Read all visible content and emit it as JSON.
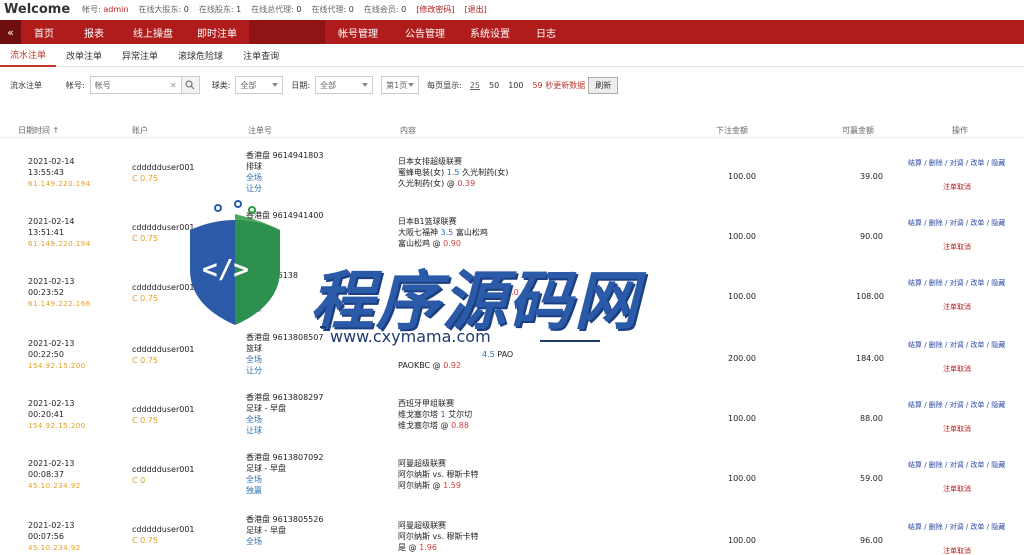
{
  "top": {
    "welcome": "Welcome",
    "account_label": "帐号:",
    "account": "admin",
    "stats": [
      {
        "label": "在线大股东:",
        "value": "0",
        "red": false
      },
      {
        "label": "在线股东:",
        "value": "1",
        "red": false
      },
      {
        "label": "在线总代理:",
        "value": "0",
        "red": false
      },
      {
        "label": "在线代理:",
        "value": "0",
        "red": false
      },
      {
        "label": "在线会员:",
        "value": "0",
        "red": false
      }
    ],
    "change_password": "[修改密码]",
    "logout": "[退出]"
  },
  "nav": {
    "collapse_icon": "«",
    "items": [
      "首页",
      "报表",
      "线上操盘",
      "即时注单",
      "",
      "帐号管理",
      "公告管理",
      "系统设置",
      "日志"
    ]
  },
  "subnav": {
    "items": [
      "流水注单",
      "改单注单",
      "异常注单",
      "滚球危险球",
      "注单查询"
    ]
  },
  "filters": {
    "section_label": "流水注单",
    "account_label": "帐号:",
    "account_placeholder": "帐号",
    "clear_icon": "✕",
    "ball_label": "球类:",
    "ball_value": "全部",
    "date_label": "日期:",
    "date_value": "全部",
    "page_value": "第1页",
    "per_page_label": "每页显示:",
    "per_page_options": [
      "25",
      "50",
      "100"
    ],
    "refresh_info": "59 秒更新数据",
    "refresh_button": "刷新"
  },
  "table": {
    "headers": [
      "日期时间 ↑",
      "账户",
      "注单号",
      "内容",
      "下注金额",
      "可赢金额",
      "操作"
    ],
    "ops_label": "结算 / 删除 / 对调 / 改单 / 隐藏",
    "cancel_label": "注单取消",
    "rows": [
      {
        "date": "2021-02-14",
        "time": "13:55:43",
        "ip": "61.149.220.194",
        "user": "cddddduser001",
        "credit": "C 0.75",
        "order": "香港盘 9614941803",
        "sport": "排球",
        "scope": "全场",
        "bet_type": "让分",
        "league": "日本女排超级联赛",
        "team_a": "蜜蜂电装(女)",
        "line": "1.5",
        "team_b": "久光制药(女)",
        "pick": "久光制药(女) @",
        "odds": "0.39",
        "stake": "100.00",
        "win": "39.00"
      },
      {
        "date": "2021-02-14",
        "time": "13:51:41",
        "ip": "61.149.220.194",
        "user": "cddddduser001",
        "credit": "C 0.75",
        "order": "香港盘 9614941400",
        "sport": "",
        "scope": "",
        "bet_type": "",
        "league": "日本B1篮球联赛",
        "team_a": "大阪七福神",
        "line": "3.5",
        "team_b": "富山松鸡",
        "pick": "富山松鸡 @",
        "odds": "0.90",
        "stake": "100.00",
        "win": "90.00"
      },
      {
        "date": "2021-02-13",
        "time": "00:23:52",
        "ip": "61.149.222.166",
        "user": "cddddduser001",
        "credit": "C 0.75",
        "order": "香港盘 96138",
        "sport": "",
        "scope": "",
        "bet_type": "滚球",
        "league": "",
        "team_a": "",
        "line": "",
        "team_b": "",
        "pick": "",
        "odds": "0.0",
        "stake": "100.00",
        "win": "108.00"
      },
      {
        "date": "2021-02-13",
        "time": "00:22:50",
        "ip": "154.92.15.200",
        "user": "cddddduser001",
        "credit": "C 0.75",
        "order": "香港盘 9613808507",
        "sport": "篮球",
        "scope": "全场",
        "bet_type": "让分",
        "league": "",
        "team_a": "",
        "line": "4.5",
        "team_b": "PAO",
        "pick": "PAOKBC @",
        "odds": "0.92",
        "stake": "200.00",
        "win": "184.00"
      },
      {
        "date": "2021-02-13",
        "time": "00:20:41",
        "ip": "154.92.15.200",
        "user": "cddddduser001",
        "credit": "C 0.75",
        "order": "香港盘 9613808297",
        "sport": "足球 - 早盘",
        "scope": "全场",
        "bet_type": "让球",
        "league": "西班牙甲组联赛",
        "team_a": "维戈塞尔塔",
        "line": "1",
        "team_b": "艾尔切",
        "pick": "维戈塞尔塔 @",
        "odds": "0.88",
        "stake": "100.00",
        "win": "88.00"
      },
      {
        "date": "2021-02-13",
        "time": "00:08:37",
        "ip": "45.10.234.92",
        "user": "cddddduser001",
        "credit": "C 0",
        "order": "香港盘 9613807092",
        "sport": "足球 - 早盘",
        "scope": "全场",
        "bet_type": "独赢",
        "league": "阿曼超级联赛",
        "team_a": "阿尔纳斯",
        "line": "vs.",
        "team_b": "穆斯卡特",
        "pick": "阿尔纳斯 @",
        "odds": "1.59",
        "stake": "100.00",
        "win": "59.00"
      },
      {
        "date": "2021-02-13",
        "time": "00:07:56",
        "ip": "45.10.234.92",
        "user": "cddddduser001",
        "credit": "C 0.75",
        "order": "香港盘 9613805526",
        "sport": "足球 - 早盘",
        "scope": "全场",
        "bet_type": "独赢",
        "league": "阿曼超级联赛",
        "team_a": "阿尔纳斯",
        "line": "vs.",
        "team_b": "穆斯卡特",
        "pick": "是 @",
        "odds": "1.96",
        "stake": "100.00",
        "win": "96.00"
      }
    ]
  },
  "watermark": {
    "title": "程序源码网",
    "url": "www.cxymama.com",
    "logo_glyph": "</>",
    "colors": {
      "blue": "#2a5aa8",
      "green": "#2e9a3e",
      "dark": "#1e3a6e"
    }
  },
  "colors": {
    "nav_bg": "#b01c1c",
    "nav_active": "#8f1414",
    "accent_red": "#c0392b",
    "ip_orange": "#e0a020",
    "link_blue": "#2a6fb0"
  }
}
